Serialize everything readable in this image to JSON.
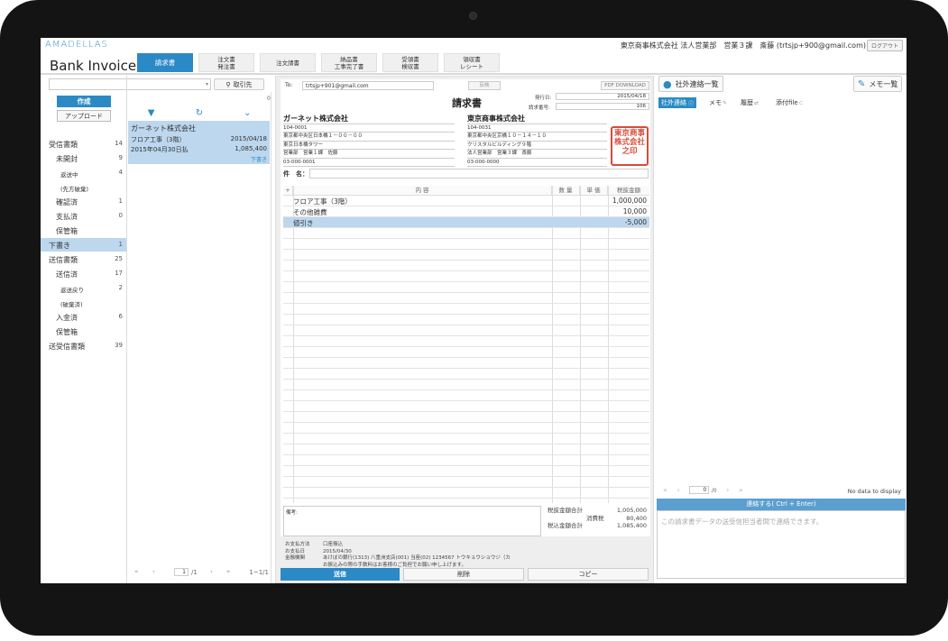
{
  "app": {
    "logo": "AMADELLAS",
    "title": "Bank Invoice",
    "user": "東京商事株式会社 法人営業部　営業３課　斎藤 (trtsjp+900@gmail.com)",
    "logout": "ログアウト"
  },
  "tabs": [
    {
      "label": "請求書",
      "active": true
    },
    {
      "label": "注文書\n発注書"
    },
    {
      "label": "注文請書"
    },
    {
      "label": "納品書\n工事完了書"
    },
    {
      "label": "受領書\n検収書"
    },
    {
      "label": "領収書\nレシート"
    }
  ],
  "sidebar": {
    "search_button": "取引先",
    "create": "作成",
    "upload": "アップロード",
    "list_count": "0",
    "items": [
      {
        "label": "受信書類",
        "count": "14",
        "level": 0
      },
      {
        "label": "未開封",
        "count": "9",
        "level": 1
      },
      {
        "label": "返送中",
        "count": "4",
        "level": 2
      },
      {
        "label": "(先方破棄)",
        "count": "",
        "level": 2
      },
      {
        "label": "確認済",
        "count": "1",
        "level": 1
      },
      {
        "label": "支払済",
        "count": "0",
        "level": 1
      },
      {
        "label": "保管箱",
        "count": "",
        "level": 1
      },
      {
        "label": "下書き",
        "count": "1",
        "level": 0,
        "active": true
      },
      {
        "label": "送信書類",
        "count": "25",
        "level": 0
      },
      {
        "label": "送信済",
        "count": "17",
        "level": 1
      },
      {
        "label": "返送戻り",
        "count": "2",
        "level": 2
      },
      {
        "label": "(破棄済)",
        "count": "",
        "level": 2
      },
      {
        "label": "入金済",
        "count": "6",
        "level": 1
      },
      {
        "label": "保管箱",
        "count": "",
        "level": 1
      },
      {
        "label": "送受信書類",
        "count": "39",
        "level": 0
      }
    ]
  },
  "list": {
    "item": {
      "company": "ガーネット株式会社",
      "subject": "フロア工事（3階）",
      "date": "2015/04/18",
      "due": "2015年04月30日払",
      "amount": "1,085,400",
      "status": "下書き"
    },
    "pager": {
      "page": "1",
      "total": "/1",
      "range": "1~1/1"
    }
  },
  "document": {
    "to_label": "To:",
    "to_value": "trtsjp+901@gmail.com",
    "hanei": "反映",
    "pdf": "PDF DOWNLOAD",
    "title": "請求書",
    "issue_label": "発行日:",
    "issue_value": "2015/04/18",
    "number_label": "請求番号:",
    "number_value": "106",
    "recipient": {
      "name": "ガーネット株式会社",
      "zip": "104-0001",
      "addr1": "東京都中央区日本橋１－００－００",
      "addr2": "東京日本橋タワー",
      "person": "営業部　営業１課　佐藤",
      "tel": "03-000-0001"
    },
    "sender": {
      "name": "東京商事株式会社",
      "zip": "104-0031",
      "addr1": "東京都中央区京橋１０－１４－１０",
      "addr2": "クリスタルビルディング９階",
      "person": "法人営業部　営業３課　斎藤",
      "tel": "03-000-0000"
    },
    "stamp": "東京商事株式会社之印",
    "subject_label": "件　名：",
    "columns": {
      "plus": "+",
      "desc": "内 容",
      "qty": "数 量",
      "price": "単 価",
      "amount": "税抜金額"
    },
    "rows": [
      {
        "desc": "フロア工事（3階）",
        "amount": "1,000,000"
      },
      {
        "desc": "その他雑費",
        "amount": "10,000"
      },
      {
        "desc": "値引き",
        "amount": "-5,000",
        "highlight": true
      }
    ],
    "bikou_label": "備考:",
    "totals": {
      "subtotal_label": "税抜金額合計",
      "subtotal": "1,005,000",
      "tax_label": "消費税",
      "tax": "80,400",
      "total_label": "税込金額合計",
      "total": "1,085,400"
    },
    "payment": {
      "method_label": "お支払方法",
      "method": "口座振込",
      "date_label": "お支払日",
      "date": "2015/04/30",
      "bank_label": "金融機関",
      "bank": "あけぼの銀行(1313) 八重洲支店(001) 当座(02) 1234567 トウキョウショウジ（カ",
      "note": "お振込みの際の手数料はお客様のご負担でお願い申し上げます。"
    },
    "buttons": {
      "send": "送信",
      "delete": "削除",
      "copy": "コピー"
    }
  },
  "right": {
    "contacts_btn": "社外連絡一覧",
    "memo_btn": "メモ一覧",
    "tabs": [
      "社外連絡",
      "メモ",
      "履歴",
      "添付file"
    ],
    "no_data": "No data to display",
    "pager_page": "0",
    "pager_total": "/0",
    "contact_bar": "連絡する( Ctrl + Enter)",
    "contact_placeholder": "この請求書データの送受信担当者間で連絡できます。"
  },
  "colors": {
    "accent": "#2b8ac6",
    "selected": "#bcd7ee",
    "stamp": "#d84b3a"
  }
}
